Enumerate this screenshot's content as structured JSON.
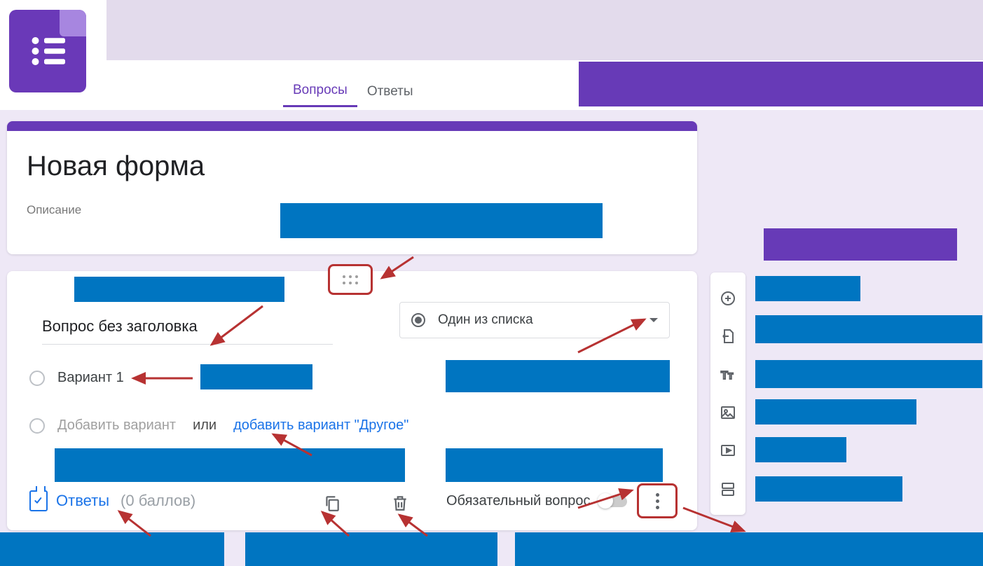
{
  "tabs": {
    "questions": "Вопросы",
    "answers": "Ответы"
  },
  "form": {
    "title": "Новая форма",
    "description": "Описание"
  },
  "question": {
    "title": "Вопрос без заголовка",
    "type_label": "Один из списка",
    "option1": "Вариант 1",
    "add_option": "Добавить вариант",
    "or": "или",
    "add_other": "добавить вариант \"Другое\""
  },
  "footer": {
    "answers_label": "Ответы",
    "points_label": "(0 баллов)",
    "required_label": "Обязательный вопрос"
  },
  "toolbar": {
    "add_question": "Добавить вопрос",
    "import": "Импортировать вопросы",
    "add_title": "Добавить название и описание",
    "add_image": "Добавить изображение",
    "add_video": "Добавить видео",
    "add_section": "Добавить раздел"
  }
}
